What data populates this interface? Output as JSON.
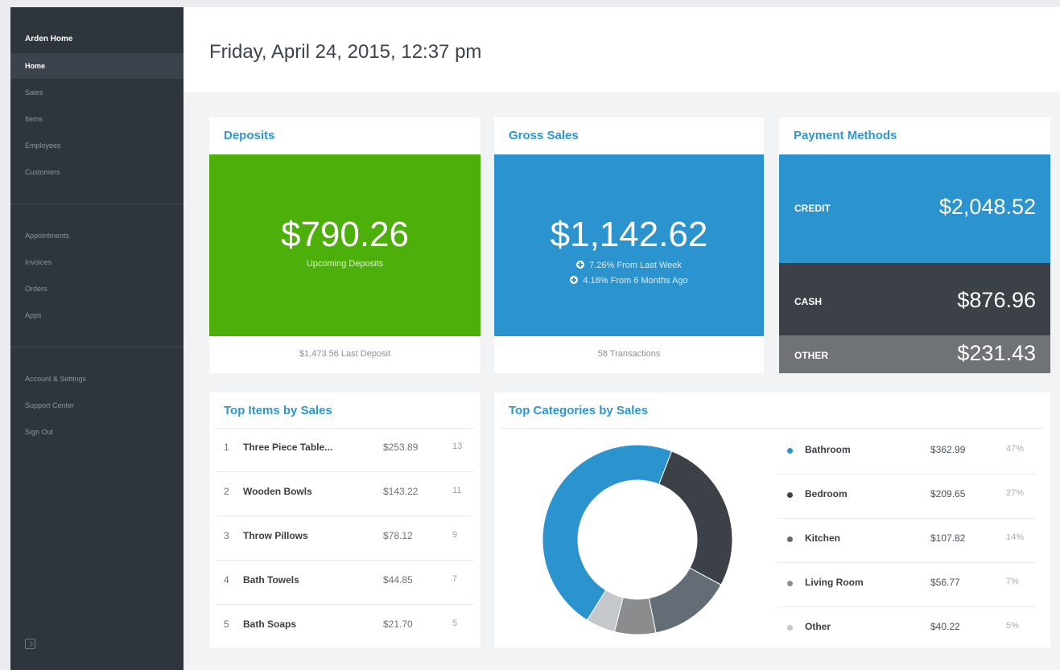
{
  "sidebar": {
    "title": "Arden Home",
    "nav_primary": [
      "Home",
      "Sales",
      "Items",
      "Employees",
      "Customers"
    ],
    "nav_secondary": [
      "Appointments",
      "Invoices",
      "Orders",
      "Apps"
    ],
    "nav_account": [
      "Account & Settings",
      "Support Center",
      "Sign Out"
    ],
    "active": "Home"
  },
  "header": {
    "datetime": "Friday, April 24, 2015, 12:37 pm"
  },
  "deposits": {
    "title": "Deposits",
    "amount": "$790.26",
    "amount_label": "Upcoming Deposits",
    "footer": "$1,473.56 Last Deposit",
    "color": "#4caf0a"
  },
  "gross_sales": {
    "title": "Gross Sales",
    "amount": "$1,142.62",
    "change_week": "7.26% From Last Week",
    "change_6mo": "4.18% From 6 Months Ago",
    "footer": "58 Transactions",
    "color": "#2b94cf"
  },
  "payment_methods": {
    "title": "Payment Methods",
    "rows": [
      {
        "label": "CREDIT",
        "value": "$2,048.52",
        "color": "#2b94cf"
      },
      {
        "label": "CASH",
        "value": "$876.96",
        "color": "#3c4148"
      },
      {
        "label": "OTHER",
        "value": "$231.43",
        "color": "#6f7277"
      }
    ]
  },
  "top_items": {
    "title": "Top Items by Sales",
    "rows": [
      {
        "rank": "1",
        "name": "Three Piece Table...",
        "amount": "$253.89",
        "qty": "13"
      },
      {
        "rank": "2",
        "name": "Wooden Bowls",
        "amount": "$143.22",
        "qty": "11"
      },
      {
        "rank": "3",
        "name": "Throw Pillows",
        "amount": "$78.12",
        "qty": "9"
      },
      {
        "rank": "4",
        "name": "Bath Towels",
        "amount": "$44.85",
        "qty": "7"
      },
      {
        "rank": "5",
        "name": "Bath Soaps",
        "amount": "$21.70",
        "qty": "5"
      }
    ]
  },
  "top_categories": {
    "title": "Top Categories by Sales",
    "rows": [
      {
        "name": "Bathroom",
        "amount": "$362.99",
        "pct": "47%",
        "color": "#2b94cf"
      },
      {
        "name": "Bedroom",
        "amount": "$209.65",
        "pct": "27%",
        "color": "#3c4148"
      },
      {
        "name": "Kitchen",
        "amount": "$107.82",
        "pct": "14%",
        "color": "#646c75"
      },
      {
        "name": "Living Room",
        "amount": "$56.77",
        "pct": "7%",
        "color": "#8a8c8e"
      },
      {
        "name": "Other",
        "amount": "$40.22",
        "pct": "5%",
        "color": "#c4c7cb"
      }
    ],
    "donut_shares": [
      47,
      27,
      14,
      7,
      5
    ]
  }
}
